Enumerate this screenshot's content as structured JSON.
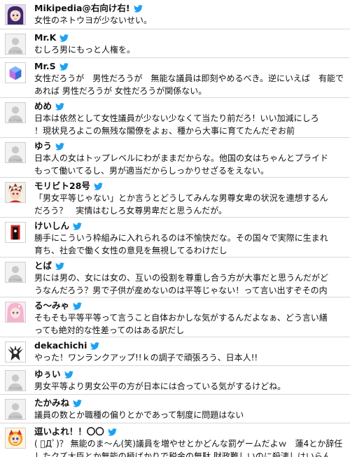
{
  "colors": {
    "bird": "#1da1f2",
    "divider": "#d8d8d8",
    "text": "#111111"
  },
  "icons": {
    "bird": "twitter-bird-icon",
    "avatars": [
      "anime-girl-avatar",
      "no-image-avatar",
      "cube-avatar",
      "no-image-avatar",
      "no-image-avatar",
      "anime-boy-avatar",
      "doorway-avatar",
      "no-image-avatar",
      "pink-hair-avatar",
      "white-figure-avatar",
      "no-image-avatar",
      "no-image-avatar",
      "mascot-avatar"
    ]
  },
  "placeholder_avatar_text": "no image",
  "tweets": [
    {
      "name": "Mikipedia@右向け右!",
      "text": "女性のネトウヨが少ないせい。"
    },
    {
      "name": "Mr.K",
      "text": "むしろ男にもっと人権を。"
    },
    {
      "name": "Mr.S",
      "text": "女性だろうが　男性だろうが　無能な議員は即刻やめるべき。逆にいえば　有能で\nあれば 男性だろうが 女性だろうが関係ない。"
    },
    {
      "name": "めめ",
      "text": "日本は依然として女性議員が少ない少なくて当たり前だろ！いい加減にしろ\n！現状見ろよこの無残な閣僚をよぉ、種から大事に育てたんだぞお前"
    },
    {
      "name": "ゆう",
      "text": "日本人の女はトップレベルにわがままだからな。他国の女はちゃんとプライド\nもって働いてるし、男が適当だからしっかりせざるをえない。"
    },
    {
      "name": "モリビト28号",
      "text": "「男女平等じゃない」とか言うとどうしてみんな男尊女卑の状況を連想するん\nだろう？　実情はむしろ女尊男卑だと思うんだが。"
    },
    {
      "name": "けいしん",
      "text": "勝手にこういう枠組みに入れられるのは不愉快だな。その国々で実際に生まれ\n育ち、社会で働く女性の意見を無視してるわけだし"
    },
    {
      "name": "とば",
      "text": "男には男の、女には女の、互いの役割を尊重し合う方が大事だと思うんだがど\nうなんだろう？男で子供が産めないのは平等じゃない！って言い出すぞその内"
    },
    {
      "name": "る～みゃ",
      "text": "そもそも平等平等って言うこと自体おかしな気がするんだよなぁ、どう言い繕\nっても絶対的な性差ってのはある訳だし"
    },
    {
      "name": "dekachichi",
      "text": "やった！ワンランクアップ!!ｋの調子で頑張ろう、日本人!!"
    },
    {
      "name": "ゆぅい",
      "text": "男女平等より男女公平の方が日本には合っている気がするけどね。"
    },
    {
      "name": "たかみね",
      "text": "議員の数とか職種の偏りとかであって制度に問題はない"
    },
    {
      "name": "逗いよれ！！〇〇",
      "text": "( ﾟДﾟ)？ 無能のま～ん(笑)議員を増やせとかどんな罰ゲームだよｗ　蓮4とか辞任\nしたクズ大臣とか無能の極ばかりで税金の無駄 財政難しいのに殺洟しはいらん"
    }
  ]
}
